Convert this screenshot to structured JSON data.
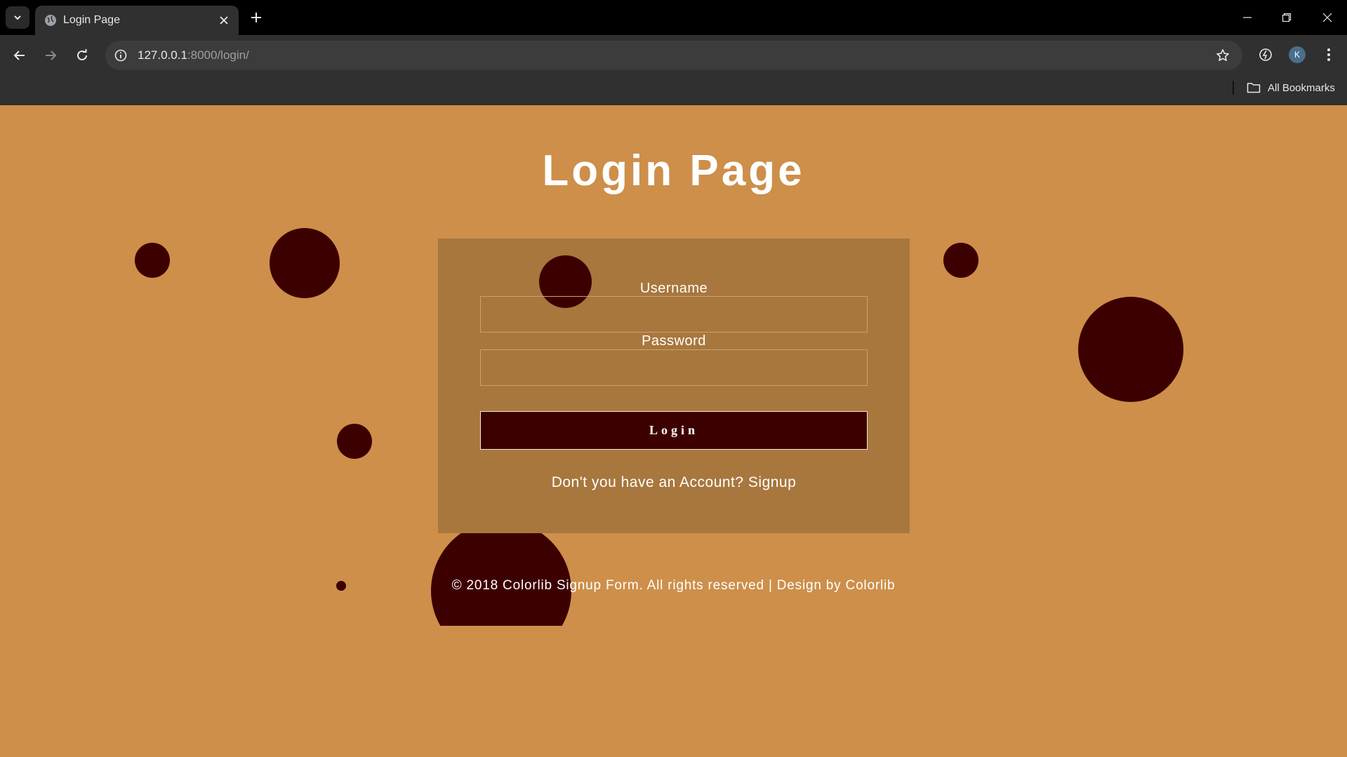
{
  "browser": {
    "tab_title": "Login Page",
    "url_host": "127.0.0.1",
    "url_path": ":8000/login/",
    "profile_initial": "K",
    "bookmarks_label": "All Bookmarks"
  },
  "page": {
    "title": "Login Page",
    "username_label": "Username",
    "username_value": "",
    "password_label": "Password",
    "password_value": "",
    "login_button": "Login",
    "signup_prompt": "Don't you have an Account?",
    "signup_link": "Signup",
    "footer_text": "© 2018 Colorlib Signup Form. All rights reserved |",
    "footer_link": "Design by Colorlib"
  },
  "colors": {
    "background": "#cd8f4a",
    "card": "#a8773d",
    "bubble": "#3d0000",
    "button": "#3d0000"
  }
}
